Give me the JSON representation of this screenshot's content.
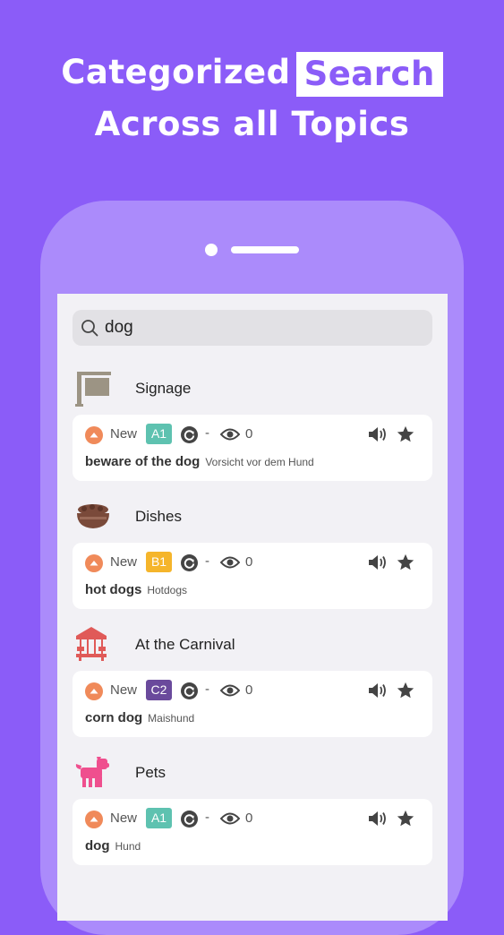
{
  "headline": {
    "line1_prefix": "Categorized",
    "line1_highlight": "Search",
    "line2": "Across all Topics"
  },
  "search": {
    "query": "dog"
  },
  "colors": {
    "background": "#8b5cf8",
    "level_A1": "#5ec2b0",
    "level_B1": "#f5b52b",
    "level_C2": "#6a4a9c",
    "status_new": "#f08a5a"
  },
  "results": [
    {
      "category": "Signage",
      "category_icon": "sign-icon",
      "card": {
        "status": "New",
        "level": "A1",
        "repeat": "-",
        "views": "0",
        "phrase": "beware of the dog",
        "translation": "Vorsicht vor dem Hund"
      }
    },
    {
      "category": "Dishes",
      "category_icon": "bowl-icon",
      "card": {
        "status": "New",
        "level": "B1",
        "repeat": "-",
        "views": "0",
        "phrase": "hot dogs",
        "translation": "Hotdogs"
      }
    },
    {
      "category": "At the Carnival",
      "category_icon": "carousel-icon",
      "card": {
        "status": "New",
        "level": "C2",
        "repeat": "-",
        "views": "0",
        "phrase": "corn dog",
        "translation": "Maishund"
      }
    },
    {
      "category": "Pets",
      "category_icon": "dog-icon",
      "card": {
        "status": "New",
        "level": "A1",
        "repeat": "-",
        "views": "0",
        "phrase": "dog",
        "translation": "Hund"
      }
    }
  ]
}
